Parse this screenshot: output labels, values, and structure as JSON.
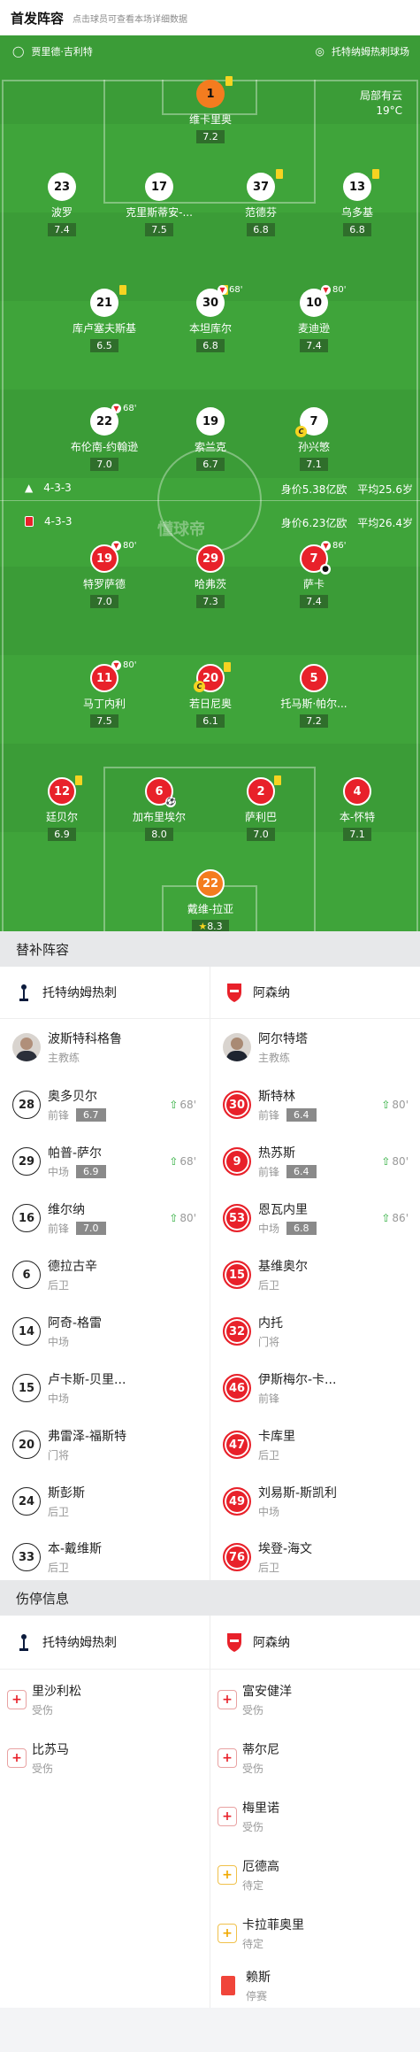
{
  "header": {
    "title": "首发阵容",
    "subtitle": "点击球员可查看本场详细数据"
  },
  "pitch": {
    "referee": "贾里德·吉利特",
    "stadium": "托特纳姆热刺球场",
    "weather": "局部有云",
    "temp": "19°C",
    "watermark": "懂球帝",
    "home": {
      "formation": "4-3-3",
      "value": "身价5.38亿欧",
      "age": "平均25.6岁"
    },
    "away": {
      "formation": "4-3-3",
      "value": "身价6.23亿欧",
      "age": "平均26.4岁"
    },
    "players": [
      {
        "num": "1",
        "name": "维卡里奥",
        "rating": "7.2"
      },
      {
        "num": "23",
        "name": "波罗",
        "rating": "7.4"
      },
      {
        "num": "17",
        "name": "克里斯蒂安-...",
        "rating": "7.5"
      },
      {
        "num": "37",
        "name": "范德芬",
        "rating": "6.8"
      },
      {
        "num": "13",
        "name": "乌多基",
        "rating": "6.8"
      },
      {
        "num": "21",
        "name": "库卢塞夫斯基",
        "rating": "6.5"
      },
      {
        "num": "30",
        "name": "本坦库尔",
        "rating": "6.8",
        "sub": "68'"
      },
      {
        "num": "10",
        "name": "麦迪逊",
        "rating": "7.4",
        "sub": "80'"
      },
      {
        "num": "22",
        "name": "布伦南-约翰逊",
        "rating": "7.0",
        "sub": "68'"
      },
      {
        "num": "19",
        "name": "索兰克",
        "rating": "6.7"
      },
      {
        "num": "7",
        "name": "孙兴慜",
        "rating": "7.1",
        "cap": "C"
      },
      {
        "num": "19",
        "name": "特罗萨德",
        "rating": "7.0",
        "sub": "80'"
      },
      {
        "num": "29",
        "name": "哈弗茨",
        "rating": "7.3"
      },
      {
        "num": "7",
        "name": "萨卡",
        "rating": "7.4",
        "sub": "86'"
      },
      {
        "num": "11",
        "name": "马丁内利",
        "rating": "7.5",
        "sub": "80'"
      },
      {
        "num": "20",
        "name": "若日尼奥",
        "rating": "6.1",
        "cap": "C"
      },
      {
        "num": "5",
        "name": "托马斯·帕尔...",
        "rating": "7.2"
      },
      {
        "num": "12",
        "name": "廷贝尔",
        "rating": "6.9"
      },
      {
        "num": "6",
        "name": "加布里埃尔",
        "rating": "8.0"
      },
      {
        "num": "2",
        "name": "萨利巴",
        "rating": "7.0"
      },
      {
        "num": "4",
        "name": "本-怀特",
        "rating": "7.1"
      },
      {
        "num": "22",
        "name": "戴维-拉亚",
        "rating": "8.3"
      }
    ]
  },
  "subs": {
    "title": "替补阵容",
    "home": {
      "team": "托特纳姆热刺",
      "coach": "波斯特科格鲁",
      "coach_role": "主教练",
      "players": [
        {
          "num": "28",
          "name": "奥多贝尔",
          "pos": "前锋",
          "rating": "6.7",
          "in": "68'"
        },
        {
          "num": "29",
          "name": "帕普-萨尔",
          "pos": "中场",
          "rating": "6.9",
          "in": "68'"
        },
        {
          "num": "16",
          "name": "维尔纳",
          "pos": "前锋",
          "rating": "7.0",
          "in": "80'"
        },
        {
          "num": "6",
          "name": "德拉古辛",
          "pos": "后卫"
        },
        {
          "num": "14",
          "name": "阿奇-格雷",
          "pos": "中场"
        },
        {
          "num": "15",
          "name": "卢卡斯-贝里...",
          "pos": "中场"
        },
        {
          "num": "20",
          "name": "弗雷泽-福斯特",
          "pos": "门将"
        },
        {
          "num": "24",
          "name": "斯彭斯",
          "pos": "后卫"
        },
        {
          "num": "33",
          "name": "本-戴维斯",
          "pos": "后卫"
        }
      ]
    },
    "away": {
      "team": "阿森纳",
      "coach": "阿尔特塔",
      "coach_role": "主教练",
      "players": [
        {
          "num": "30",
          "name": "斯特林",
          "pos": "前锋",
          "rating": "6.4",
          "in": "80'"
        },
        {
          "num": "9",
          "name": "热苏斯",
          "pos": "前锋",
          "rating": "6.4",
          "in": "80'"
        },
        {
          "num": "53",
          "name": "恩瓦内里",
          "pos": "中场",
          "rating": "6.8",
          "in": "86'"
        },
        {
          "num": "15",
          "name": "基维奥尔",
          "pos": "后卫"
        },
        {
          "num": "32",
          "name": "内托",
          "pos": "门将"
        },
        {
          "num": "46",
          "name": "伊斯梅尔-卡...",
          "pos": "前锋"
        },
        {
          "num": "47",
          "name": "卡库里",
          "pos": "后卫"
        },
        {
          "num": "49",
          "name": "刘易斯-斯凯利",
          "pos": "中场"
        },
        {
          "num": "76",
          "name": "埃登-海文",
          "pos": "后卫"
        }
      ]
    }
  },
  "injuries": {
    "title": "伤停信息",
    "home": {
      "team": "托特纳姆热刺",
      "players": [
        {
          "name": "里沙利松",
          "status": "受伤"
        },
        {
          "name": "比苏马",
          "status": "受伤"
        }
      ]
    },
    "away": {
      "team": "阿森纳",
      "players": [
        {
          "name": "富安健洋",
          "status": "受伤"
        },
        {
          "name": "蒂尔尼",
          "status": "受伤"
        },
        {
          "name": "梅里诺",
          "status": "受伤"
        },
        {
          "name": "厄德高",
          "status": "待定"
        },
        {
          "name": "卡拉菲奥里",
          "status": "待定"
        },
        {
          "name": "赖斯",
          "status": "停赛"
        }
      ]
    }
  },
  "colors": {
    "pitch": "#3fa43a",
    "arsenal_red": "#e8212a",
    "keeper_orange": "#f47c1f",
    "sub_green": "#2eae3d"
  }
}
